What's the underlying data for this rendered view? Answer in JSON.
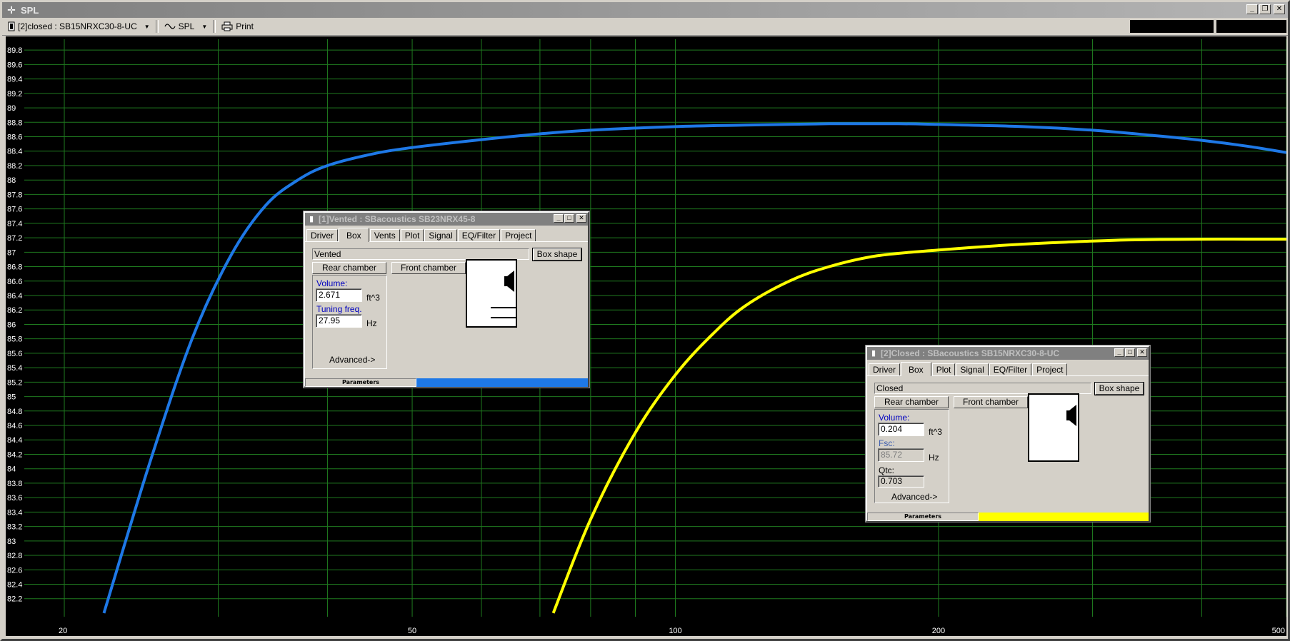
{
  "window": {
    "title": "SPL",
    "controls": {
      "minimize": "_",
      "restore": "❐",
      "close": "✕"
    }
  },
  "toolbar": {
    "project_select": "[2]closed : SB15NRXC30-8-UC",
    "view_select": "SPL",
    "print_label": "Print"
  },
  "chart_data": {
    "type": "line",
    "title": "",
    "xlabel": "",
    "ylabel": "",
    "x_scale": "log",
    "xlim": [
      18,
      500
    ],
    "ylim": [
      81.95,
      89.95
    ],
    "grid": true,
    "y_ticks": [
      "89.8",
      "89.6",
      "89.4",
      "89.2",
      "89",
      "88.8",
      "88.6",
      "88.4",
      "88.2",
      "88",
      "87.8",
      "87.6",
      "87.4",
      "87.2",
      "87",
      "86.8",
      "86.6",
      "86.4",
      "86.2",
      "86",
      "85.8",
      "85.6",
      "85.4",
      "85.2",
      "85",
      "84.8",
      "84.6",
      "84.4",
      "84.2",
      "84",
      "83.8",
      "83.6",
      "83.4",
      "83.2",
      "83",
      "82.8",
      "82.6",
      "82.4",
      "82.2"
    ],
    "x_tick_labels": [
      {
        "value": 20,
        "label": "20"
      },
      {
        "value": 50,
        "label": "50"
      },
      {
        "value": 100,
        "label": "100"
      },
      {
        "value": 200,
        "label": "200"
      },
      {
        "value": 500,
        "label": "500"
      }
    ],
    "x_grid": [
      20,
      30,
      40,
      50,
      60,
      70,
      80,
      90,
      100,
      200,
      300,
      400,
      500
    ],
    "series": [
      {
        "color": "#1e78e6",
        "x": [
          22.2,
          25,
          28,
          31,
          34,
          37,
          40,
          45,
          50,
          60,
          70,
          80,
          100,
          120,
          150,
          180,
          200,
          250,
          300,
          350,
          400,
          450,
          500
        ],
        "y": [
          82.0,
          84.05,
          85.8,
          86.95,
          87.65,
          88.0,
          88.2,
          88.36,
          88.45,
          88.56,
          88.64,
          88.69,
          88.74,
          88.76,
          88.78,
          88.78,
          88.77,
          88.74,
          88.69,
          88.62,
          88.55,
          88.47,
          88.38
        ]
      },
      {
        "color": "#ffff00",
        "x": [
          72.5,
          80,
          90,
          100,
          110,
          120,
          135,
          150,
          170,
          200,
          240,
          280,
          330,
          400,
          450,
          500
        ],
        "y": [
          82.0,
          83.3,
          84.5,
          85.3,
          85.85,
          86.25,
          86.6,
          86.8,
          86.95,
          87.03,
          87.1,
          87.14,
          87.17,
          87.18,
          87.18,
          87.18
        ]
      }
    ]
  },
  "vented_window": {
    "title": "[1]Vented : SBacoustics SB23NRX45-8",
    "tabs": [
      "Driver",
      "Box",
      "Vents",
      "Plot",
      "Signal",
      "EQ/Filter",
      "Project"
    ],
    "active_tab": "Box",
    "box_type": "Vented",
    "box_shape_label": "Box shape",
    "rear_chamber_label": "Rear chamber",
    "front_chamber_label": "Front chamber",
    "volume_label": "Volume:",
    "volume_value": "2.671",
    "volume_unit": "ft^3",
    "tuning_label": "Tuning freq.",
    "tuning_value": "27.95",
    "tuning_unit": "Hz",
    "advanced_label": "Advanced->",
    "status_label": "Parameters",
    "status_color": "#1e78e6"
  },
  "closed_window": {
    "title": "[2]Closed : SBacoustics SB15NRXC30-8-UC",
    "tabs": [
      "Driver",
      "Box",
      "Plot",
      "Signal",
      "EQ/Filter",
      "Project"
    ],
    "active_tab": "Box",
    "box_type": "Closed",
    "box_shape_label": "Box shape",
    "rear_chamber_label": "Rear chamber",
    "front_chamber_label": "Front chamber",
    "volume_label": "Volume:",
    "volume_value": "0.204",
    "volume_unit": "ft^3",
    "fsc_label": "Fsc:",
    "fsc_value": "85.72",
    "fsc_unit": "Hz",
    "qtc_label": "Qtc:",
    "qtc_value": "0.703",
    "advanced_label": "Advanced->",
    "status_label": "Parameters",
    "status_color": "#ffff00"
  }
}
